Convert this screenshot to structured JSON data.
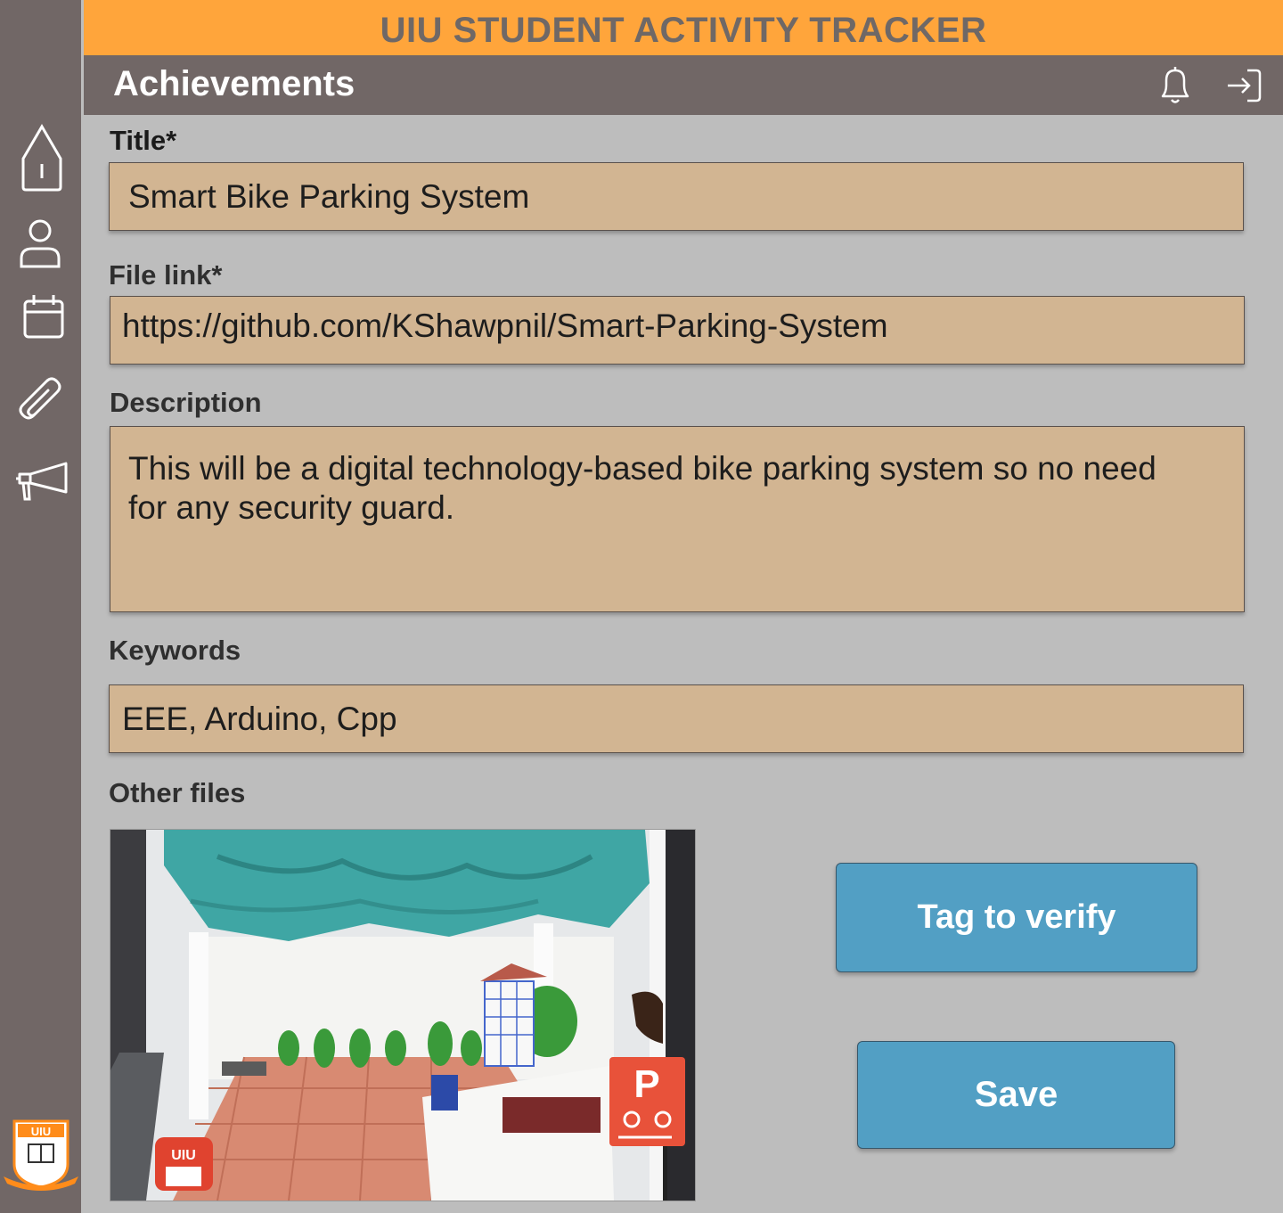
{
  "app": {
    "title": "UIU STUDENT ACTIVITY TRACKER"
  },
  "header": {
    "title": "Achievements",
    "icons": [
      "bell-icon",
      "logout-icon"
    ]
  },
  "sidebar": {
    "items": [
      {
        "icon": "home-icon"
      },
      {
        "icon": "user-icon"
      },
      {
        "icon": "calendar-icon"
      },
      {
        "icon": "paperclip-icon"
      },
      {
        "icon": "megaphone-icon"
      }
    ],
    "logo_text": "UIU"
  },
  "form": {
    "title": {
      "label": "Title*",
      "value": "Smart Bike Parking System"
    },
    "file_link": {
      "label": "File link*",
      "value": "https://github.com/KShawpnil/Smart-Parking-System"
    },
    "description": {
      "label": "Description",
      "line1": "This will be a digital technology-based bike parking system so no need",
      "line2": "for any security guard."
    },
    "keywords": {
      "label": "Keywords",
      "value": "EEE, Arduino, Cpp"
    },
    "other_files": {
      "label": "Other files"
    }
  },
  "photo": {
    "sign_letter": "P",
    "logo_text": "UIU"
  },
  "actions": {
    "tag_label": "Tag to verify",
    "save_label": "Save"
  },
  "colors": {
    "topbar": "#ffa53b",
    "header": "#716766",
    "field": "#d2b592",
    "button": "#529fc4",
    "background": "#bdbdbd"
  }
}
